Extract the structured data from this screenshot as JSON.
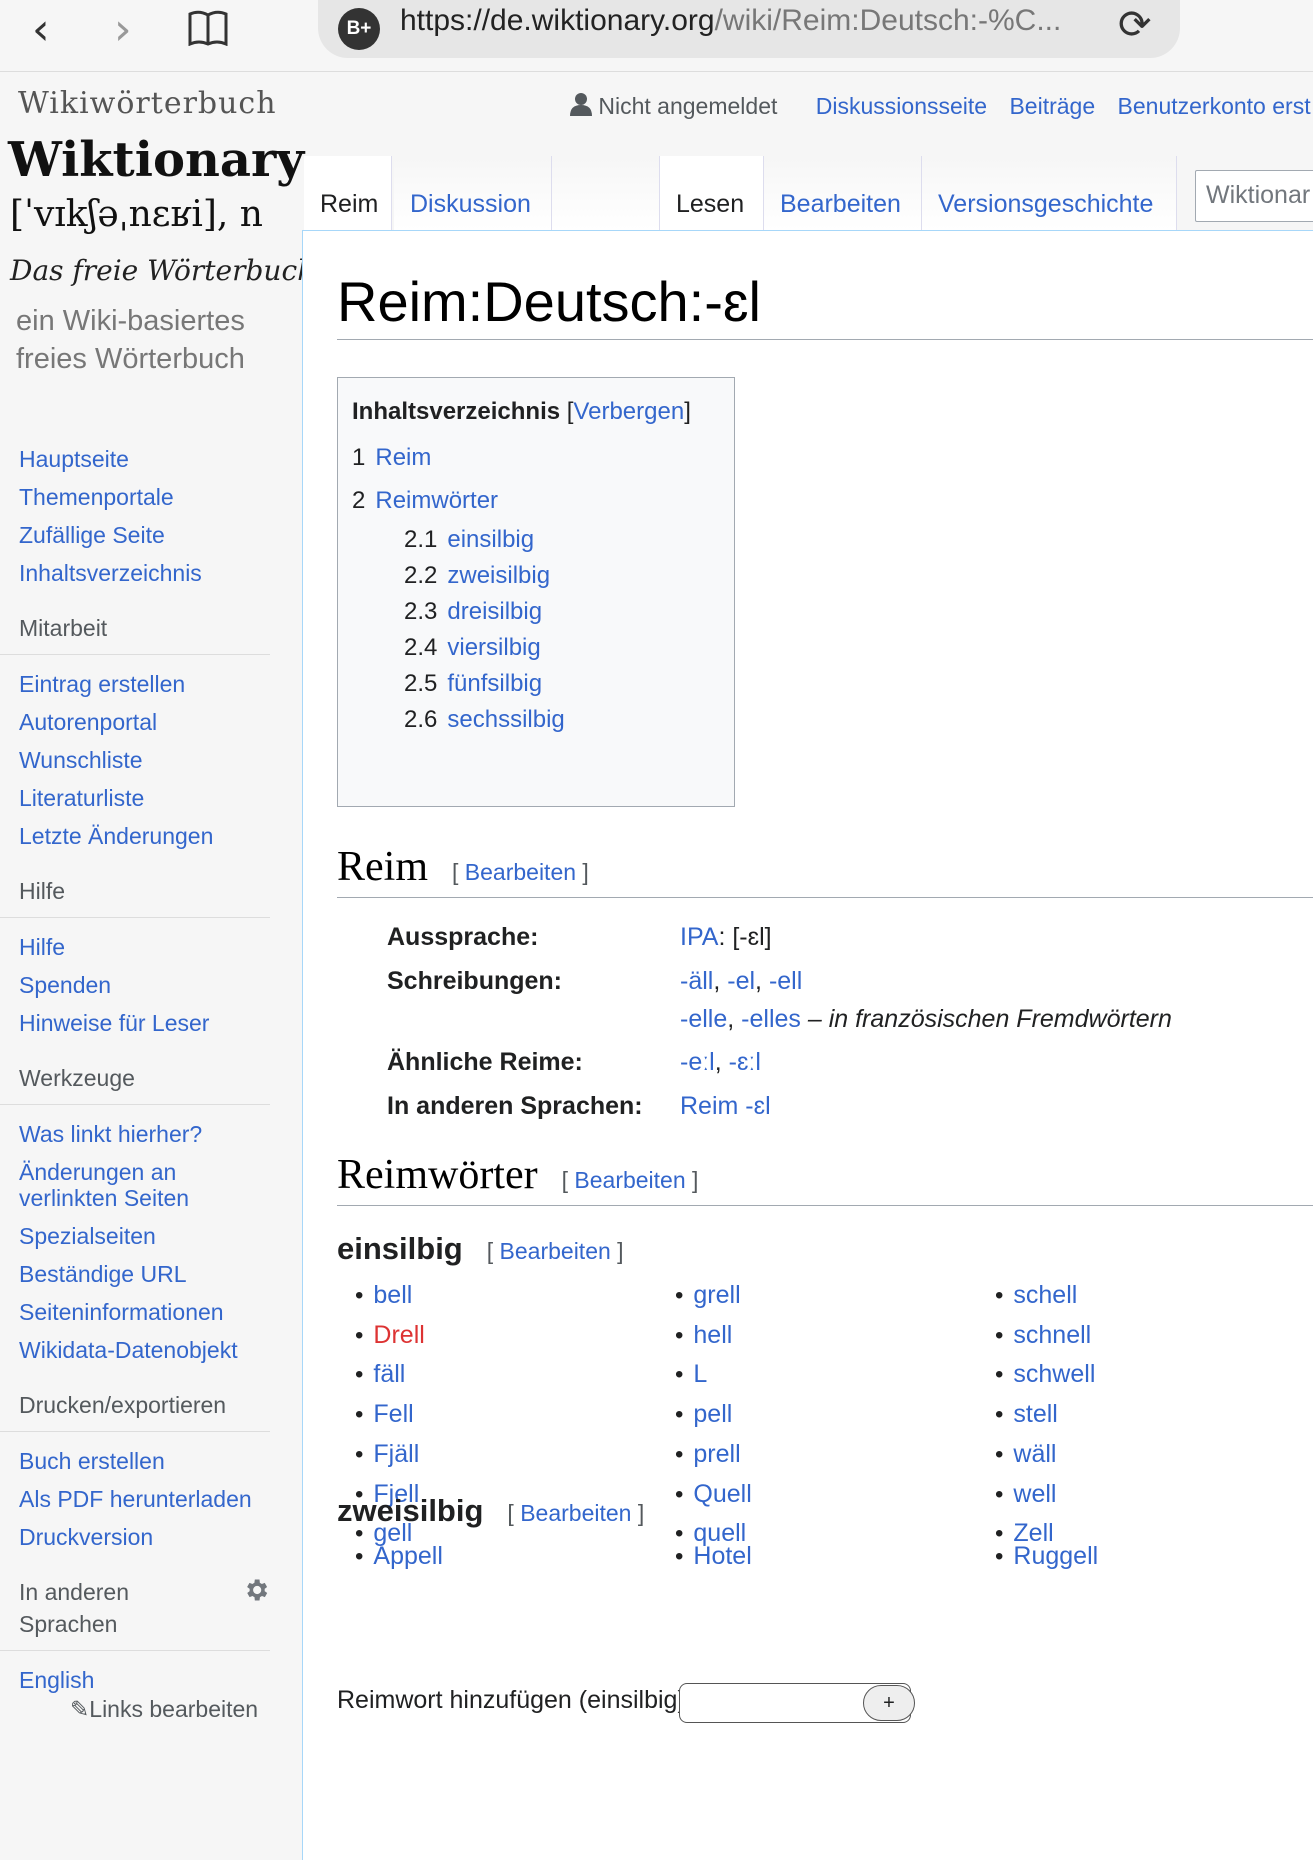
{
  "browser": {
    "url_host": "https://de.wiktionary.org",
    "url_rest": "/wiki/Reim:Deutsch:-%C...",
    "badge": "B+"
  },
  "logo": {
    "line1": "Wikiwörterbuch",
    "line2": "Wiktionary",
    "line3": "[ˈvɪkʃəˌnɛʁi], n",
    "line4": "Das freie Wörterbuch",
    "line5": "ein Wiki-basiertes freies Wörterbuch"
  },
  "sidebar": {
    "main": [
      "Hauptseite",
      "Themenportale",
      "Zufällige Seite",
      "Inhaltsverzeichnis"
    ],
    "mitarbeit_head": "Mitarbeit",
    "mitarbeit": [
      "Eintrag erstellen",
      "Autorenportal",
      "Wunschliste",
      "Literaturliste",
      "Letzte Änderungen"
    ],
    "hilfe_head": "Hilfe",
    "hilfe": [
      "Hilfe",
      "Spenden",
      "Hinweise für Leser"
    ],
    "werkzeuge_head": "Werkzeuge",
    "werkzeuge": [
      "Was linkt hierher?",
      "Änderungen an verlinkten Seiten",
      "Spezialseiten",
      "Beständige URL",
      "Seiteninformationen",
      "Wikidata-Datenobjekt"
    ],
    "drucken_head": "Drucken/exportieren",
    "drucken": [
      "Buch erstellen",
      "Als PDF herunterladen",
      "Druckversion"
    ],
    "sprachen_head": "In anderen Sprachen",
    "sprachen": [
      "English"
    ],
    "links_bearbeiten": "Links bearbeiten"
  },
  "personal": {
    "user": "Nicht angemeldet",
    "discussion": "Diskussionsseite",
    "contributions": "Beiträge",
    "create_account": "Benutzerkonto erst"
  },
  "tabs": {
    "page": "Reim",
    "talk": "Diskussion",
    "read": "Lesen",
    "edit": "Bearbeiten",
    "history": "Versionsgeschichte"
  },
  "search": {
    "placeholder": "Wiktionar"
  },
  "page": {
    "title": "Reim:Deutsch:-ɛl",
    "toc": {
      "title": "Inhaltsverzeichnis",
      "toggle": "Verbergen",
      "items": [
        {
          "num": "1",
          "label": "Reim"
        },
        {
          "num": "2",
          "label": "Reimwörter"
        },
        {
          "num": "2.1",
          "label": "einsilbig"
        },
        {
          "num": "2.2",
          "label": "zweisilbig"
        },
        {
          "num": "2.3",
          "label": "dreisilbig"
        },
        {
          "num": "2.4",
          "label": "viersilbig"
        },
        {
          "num": "2.5",
          "label": "fünfsilbig"
        },
        {
          "num": "2.6",
          "label": "sechssilbig"
        }
      ]
    },
    "edit_label": "Bearbeiten",
    "reim_heading": "Reim",
    "info": {
      "aussprache_label": "Aussprache:",
      "ipa_link": "IPA",
      "ipa_value": ": [-ɛl]",
      "schreib_label": "Schreibungen:",
      "schreib_links1": [
        "-äll",
        "-el",
        "-ell"
      ],
      "schreib_links2": [
        "-elle",
        "-elles"
      ],
      "schreib_note": "– in französischen Fremdwörtern",
      "aehnlich_label": "Ähnliche Reime:",
      "aehnlich_links": [
        "-eːl",
        "-ɛːl"
      ],
      "andere_label": "In anderen Sprachen:",
      "andere_link": "Reim -ɛl"
    },
    "reimwoerter_heading": "Reimwörter",
    "einsilbig_heading": "einsilbig",
    "einsilbig": {
      "col1": [
        {
          "t": "bell"
        },
        {
          "t": "Drell",
          "missing": true
        },
        {
          "t": "fäll"
        },
        {
          "t": "Fell"
        },
        {
          "t": "Fjäll"
        },
        {
          "t": "Fjell"
        },
        {
          "t": "gell"
        }
      ],
      "col2": [
        {
          "t": "grell"
        },
        {
          "t": "hell"
        },
        {
          "t": "L"
        },
        {
          "t": "pell"
        },
        {
          "t": "prell"
        },
        {
          "t": "Quell"
        },
        {
          "t": "quell"
        }
      ],
      "col3": [
        {
          "t": "schell"
        },
        {
          "t": "schnell"
        },
        {
          "t": "schwell"
        },
        {
          "t": "stell"
        },
        {
          "t": "wäll"
        },
        {
          "t": "well"
        },
        {
          "t": "Zell"
        }
      ]
    },
    "add_label": "Reimwort hinzufügen (einsilbig):",
    "add_button": "+",
    "zweisilbig_heading": "zweisilbig",
    "zweisilbig": [
      "Appell",
      "Hotel",
      "Ruggell"
    ]
  }
}
